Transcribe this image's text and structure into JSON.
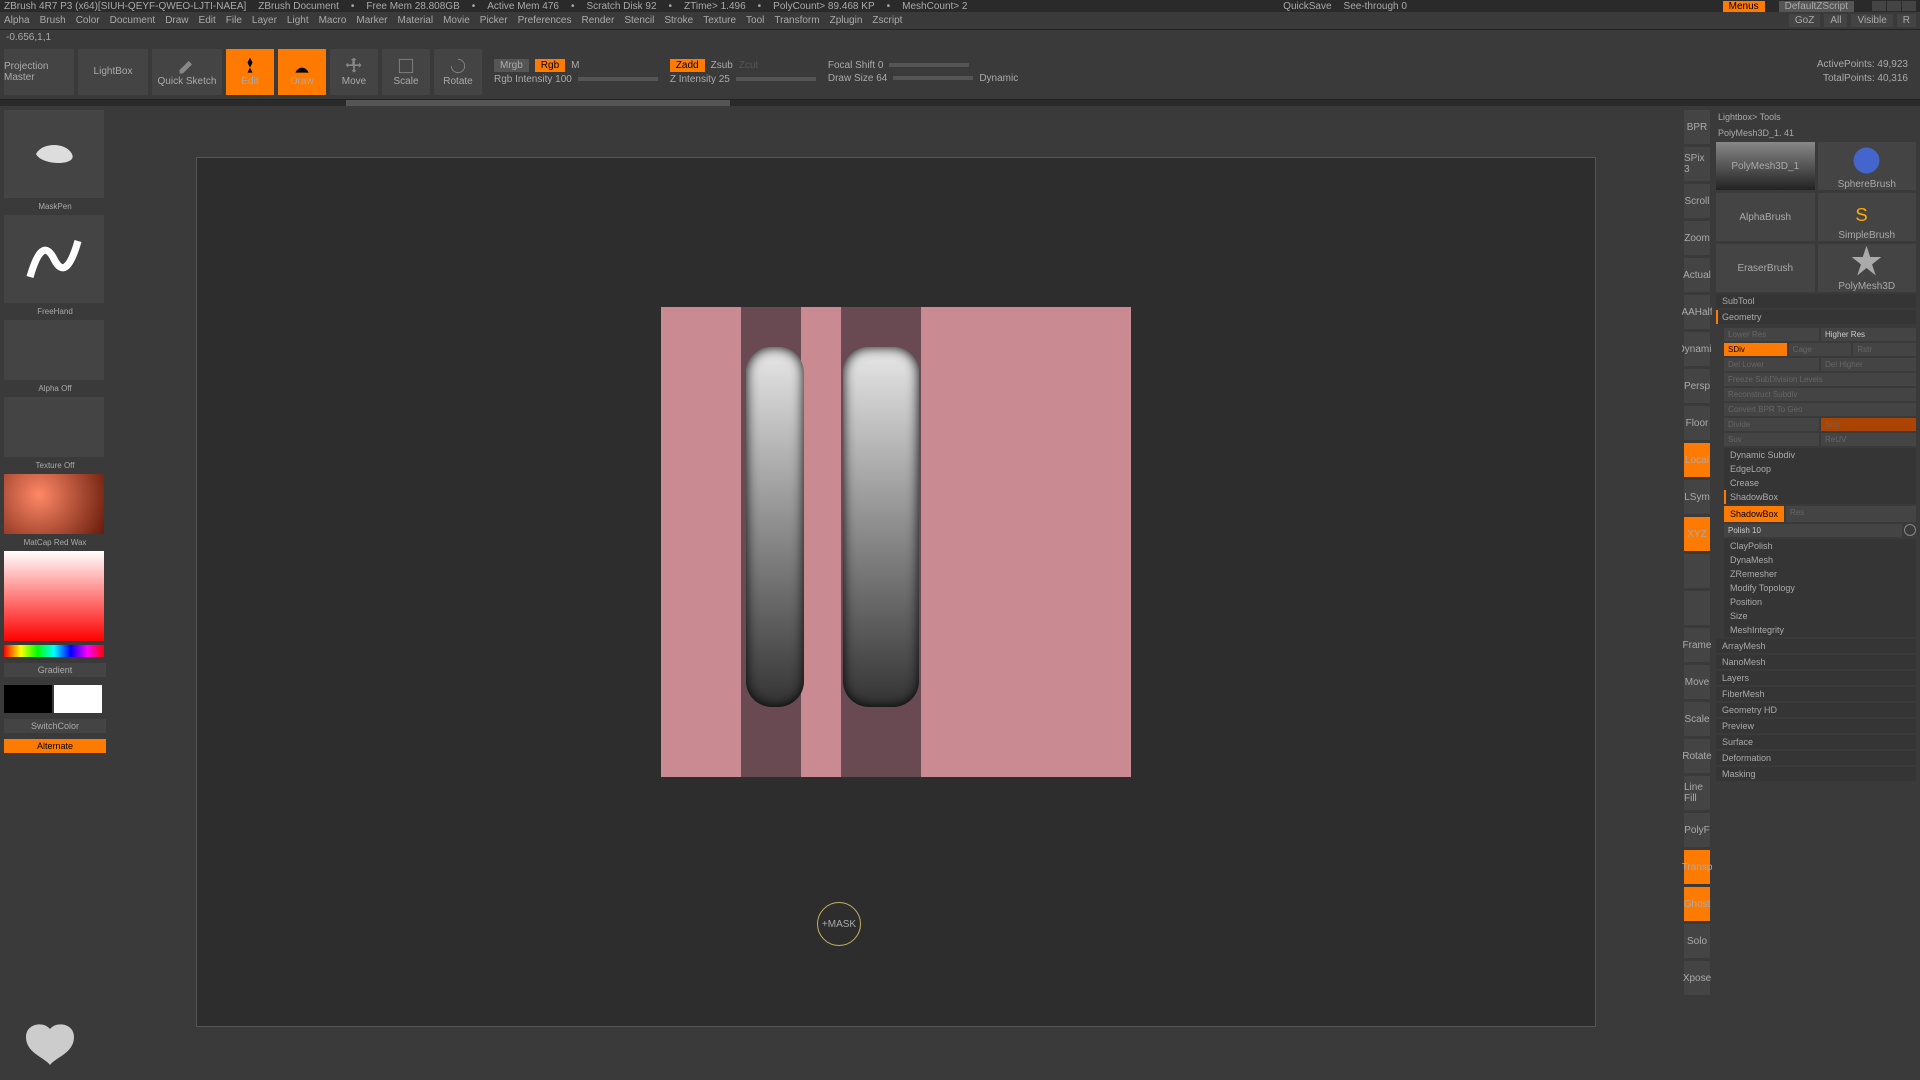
{
  "titlebar": {
    "app": "ZBrush 4R7 P3 (x64)[SIUH-QEYF-QWEO-LJTI-NAEA]",
    "doc": "ZBrush Document",
    "freemem": "Free Mem 28.808GB",
    "activemem": "Active Mem 476",
    "scratch": "Scratch Disk 92",
    "ztime": "ZTime> 1.496",
    "polycount": "PolyCount> 89.468 KP",
    "meshcount": "MeshCount> 2",
    "quicksave": "QuickSave",
    "seethrough": "See-through   0",
    "menus": "Menus",
    "defaultscript": "DefaultZScript"
  },
  "menu": {
    "items": [
      "Alpha",
      "Brush",
      "Color",
      "Document",
      "Draw",
      "Edit",
      "File",
      "Layer",
      "Light",
      "Macro",
      "Marker",
      "Material",
      "Movie",
      "Picker",
      "Preferences",
      "Render",
      "Stencil",
      "Stroke",
      "Texture",
      "Tool",
      "Transform",
      "Zplugin",
      "Zscript"
    ],
    "right": {
      "goz": "GoZ",
      "all": "All",
      "visible": "Visible",
      "r": "R"
    }
  },
  "statusline": "-0.656,1,1",
  "toolbar": {
    "projection": "Projection\nMaster",
    "lightbox": "LightBox",
    "quicksketch": "Quick\nSketch",
    "edit": "Edit",
    "draw": "Draw",
    "move": "Move",
    "scale": "Scale",
    "rotate": "Rotate",
    "mrgb": "Mrgb",
    "rgb": "Rgb",
    "m": "M",
    "rgbintensity": "Rgb Intensity 100",
    "zadd": "Zadd",
    "zsub": "Zsub",
    "zcut": "Zcut",
    "zintensity": "Z Intensity 25",
    "focalshift": "Focal Shift 0",
    "drawsize": "Draw Size 64",
    "dynamic": "Dynamic",
    "activepoints": "ActivePoints: 49,923",
    "totalpoints": "TotalPoints: 40,316"
  },
  "left": {
    "brush": "MaskPen",
    "stroke": "FreeHand",
    "alpha": "Alpha Off",
    "texture": "Texture Off",
    "material": "MatCap Red Wax",
    "gradient": "Gradient",
    "switchcolor": "SwitchColor",
    "alternate": "Alternate"
  },
  "midbar": {
    "items": [
      "BPR",
      "SPix 3",
      "Scroll",
      "Zoom",
      "Actual",
      "AAHalf",
      "Dynamic",
      "Persp",
      "Floor",
      "Local",
      "LSym",
      "XYZ",
      "",
      "",
      "Frame",
      "Move",
      "Scale",
      "Rotate",
      "Line Fill",
      "PolyF",
      "Transp",
      "Ghost",
      "Solo",
      "Xpose"
    ]
  },
  "right": {
    "header": "Lightbox> Tools",
    "tool": "PolyMesh3D_1. 41",
    "thumbs": [
      "PolyMesh3D_1",
      "SphereBrush",
      "AlphaBrush",
      "SimpleBrush",
      "EraserBrush",
      "PolyMesh3D",
      "PolyMesh3D_1"
    ],
    "subtool": "SubTool",
    "geometry": {
      "label": "Geometry",
      "lowerres": "Lower Res",
      "higherres": "Higher Res",
      "sdiv": "SDiv",
      "cage": "Cage",
      "rstr": "Rstr",
      "dellower": "Del Lower",
      "delhigher": "Del Higher",
      "freeze": "Freeze SubDivision Levels",
      "reconstruct": "Reconstruct Subdiv",
      "convert": "Convert BPR To Geo",
      "divide": "Divide",
      "smt": "Smt",
      "suv": "Suv",
      "resuv": "ReUV",
      "dynamicsubdiv": "Dynamic Subdiv",
      "edgeloop": "EdgeLoop",
      "crease": "Crease",
      "shadowbox_label": "ShadowBox",
      "shadowbox_btn": "ShadowBox",
      "res": "Res",
      "polish": "Polish 10",
      "claypolish": "ClayPolish",
      "dynamesh": "DynaMesh",
      "zremesher": "ZRemesher",
      "modifytopo": "Modify Topology",
      "position": "Position",
      "size": "Size",
      "meshintegrity": "MeshIntegrity"
    },
    "sections": [
      "ArrayMesh",
      "NanoMesh",
      "Layers",
      "FiberMesh",
      "Geometry HD",
      "Preview",
      "Surface",
      "Deformation",
      "Masking"
    ]
  },
  "cursor": "+MASK"
}
